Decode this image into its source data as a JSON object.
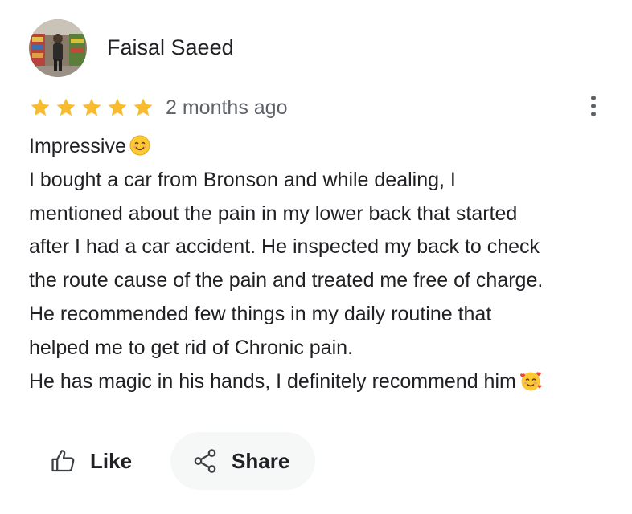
{
  "review": {
    "author_name": "Faisal Saeed",
    "avatar_icon": "user-photo-avatar",
    "rating": 5,
    "rating_max": 5,
    "time_ago": "2 months ago",
    "lines": [
      "Impressive",
      "I bought a car from Bronson and while dealing, I",
      "mentioned about the pain in my lower back that started",
      "after I had a car accident. He inspected my back to check",
      "the route cause of the pain and treated me free of charge.",
      "He recommended few things in my daily routine that",
      "helped me to get rid of Chronic pain.",
      "He has magic in his hands, I definitely recommend him"
    ],
    "first_line_emoji": "smiling-face-icon",
    "last_line_emoji": "smiling-face-with-hearts-icon"
  },
  "actions": {
    "like_label": "Like",
    "like_icon": "thumbs-up-icon",
    "share_label": "Share",
    "share_icon": "share-icon"
  },
  "menu": {
    "more_icon": "more-vert-icon"
  },
  "colors": {
    "star": "#f6bb2f",
    "secondary_text": "#5f6368",
    "share_bg": "#f6f7f7"
  }
}
